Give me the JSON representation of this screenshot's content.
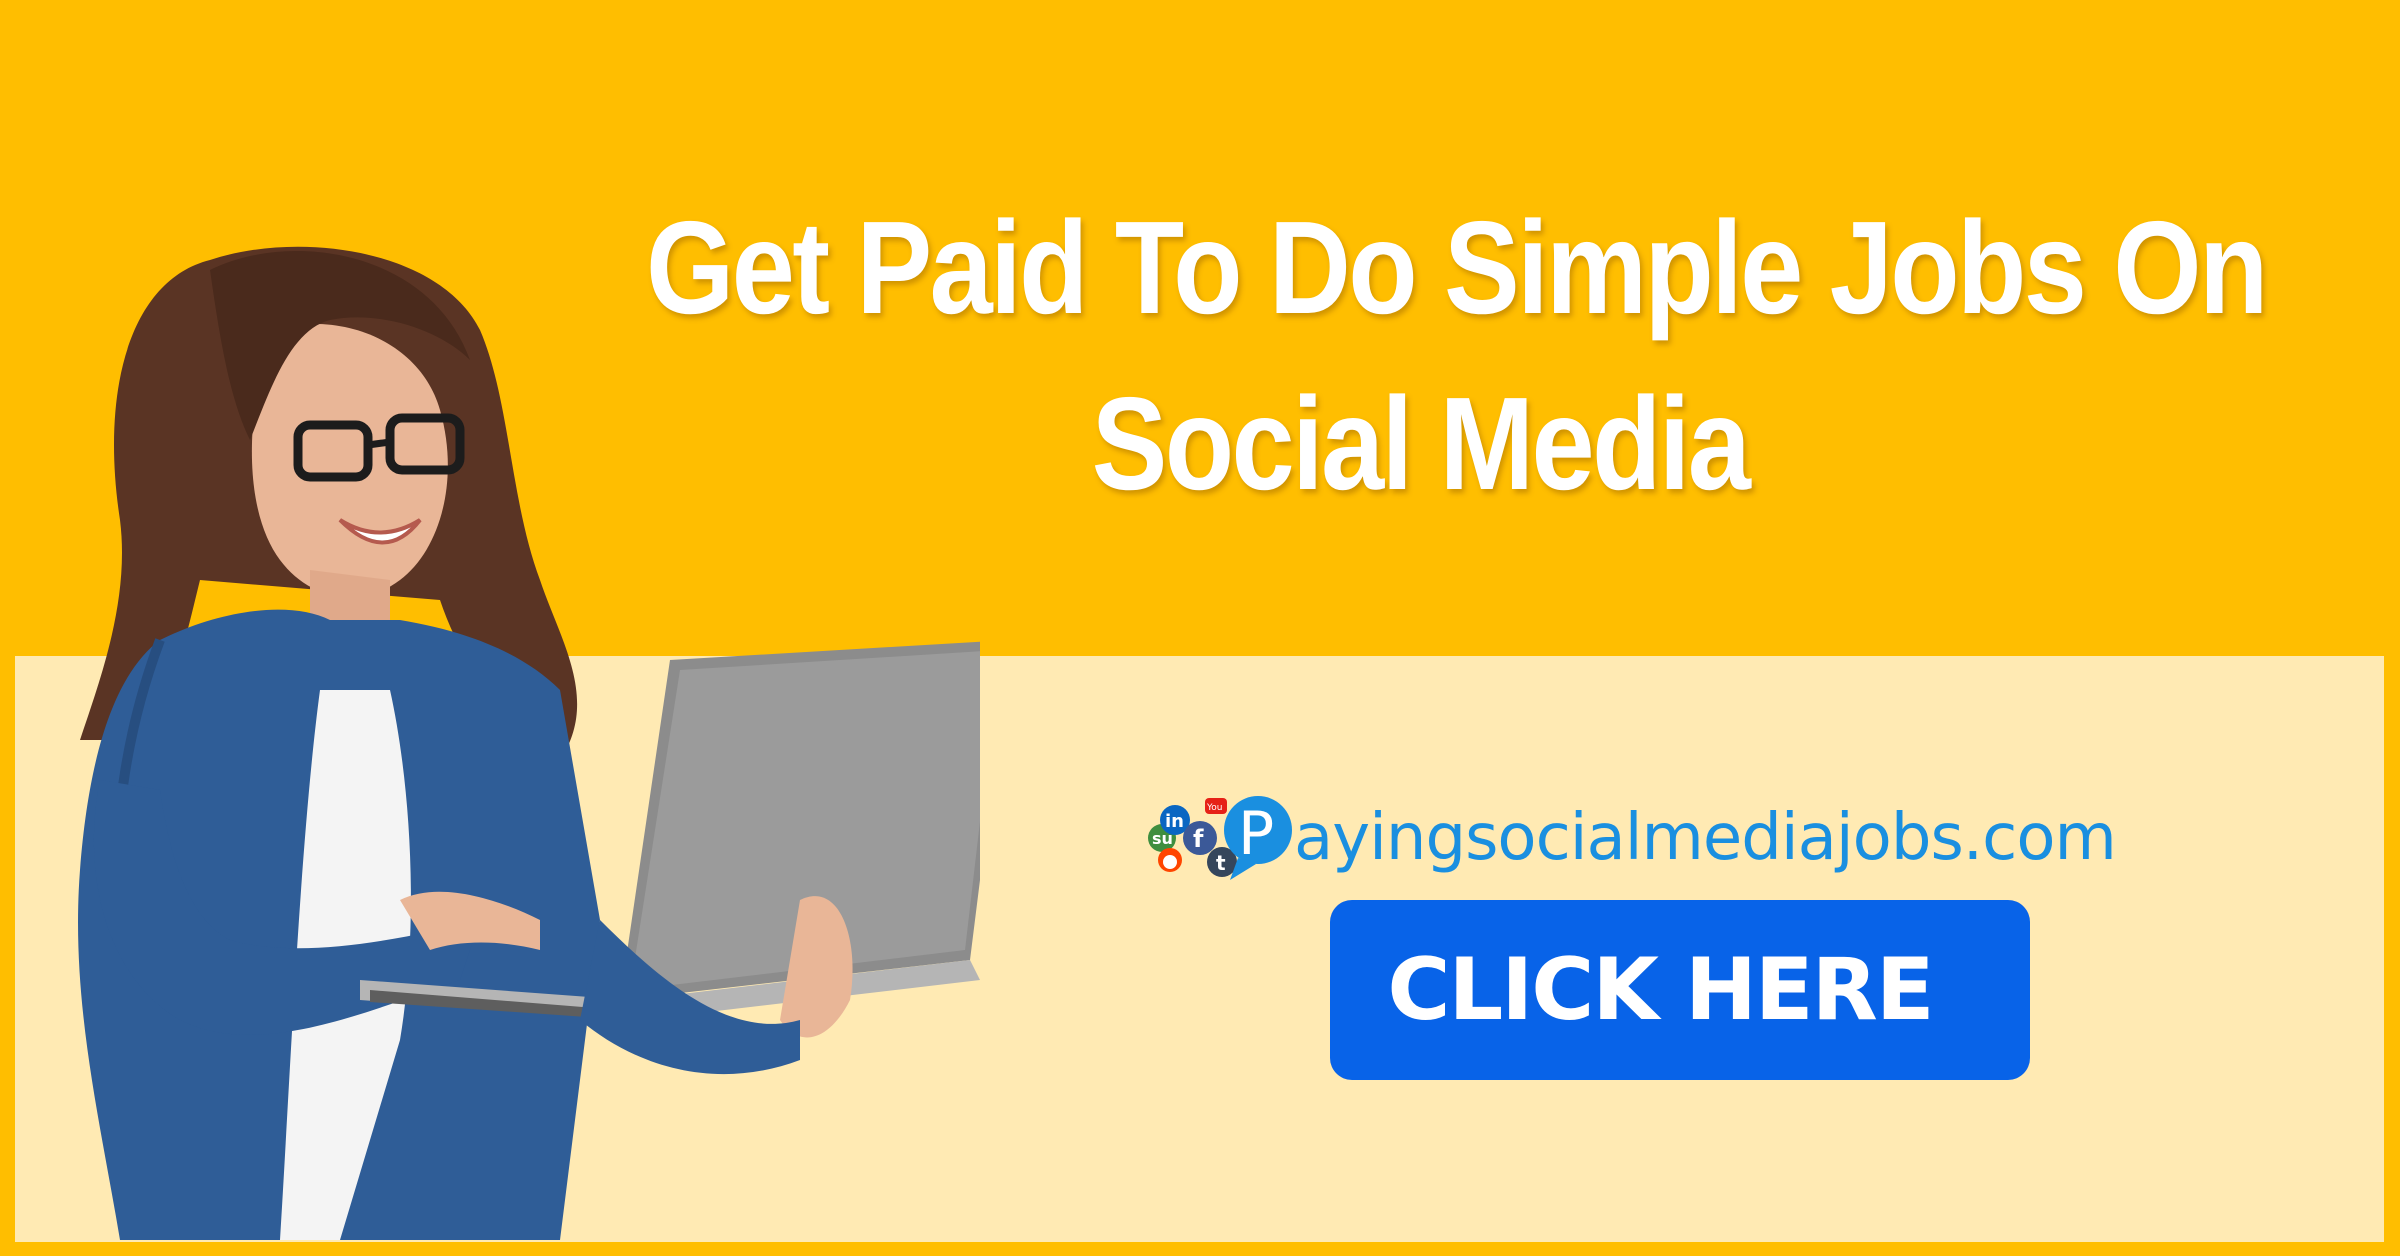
{
  "headline": {
    "line1": "Get Paid To Do Simple Jobs On",
    "line2": "Social Media"
  },
  "logo": {
    "text": "ayingsocialmediajobs.com",
    "icon": "social-media-icons-p-logo"
  },
  "cta": {
    "label": "CLICK HERE"
  },
  "colors": {
    "background": "#FFBE00",
    "panel": "#FFEAB3",
    "button": "#0863E8",
    "logo_text": "#1A8FE0"
  }
}
